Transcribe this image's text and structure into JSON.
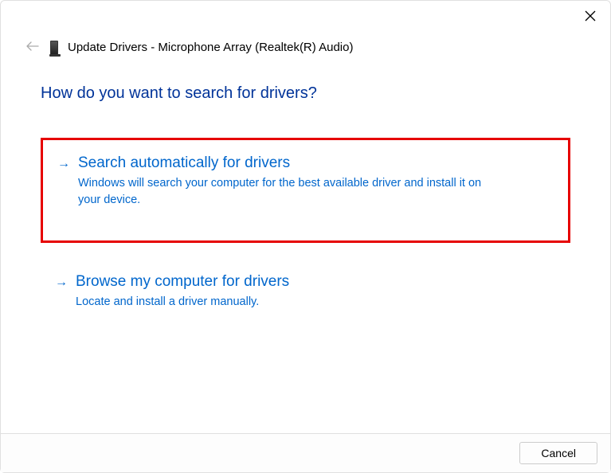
{
  "header": {
    "title": "Update Drivers - Microphone Array (Realtek(R) Audio)"
  },
  "question": "How do you want to search for drivers?",
  "options": [
    {
      "title": "Search automatically for drivers",
      "desc": "Windows will search your computer for the best available driver and install it on your device."
    },
    {
      "title": "Browse my computer for drivers",
      "desc": "Locate and install a driver manually."
    }
  ],
  "footer": {
    "cancel": "Cancel"
  }
}
